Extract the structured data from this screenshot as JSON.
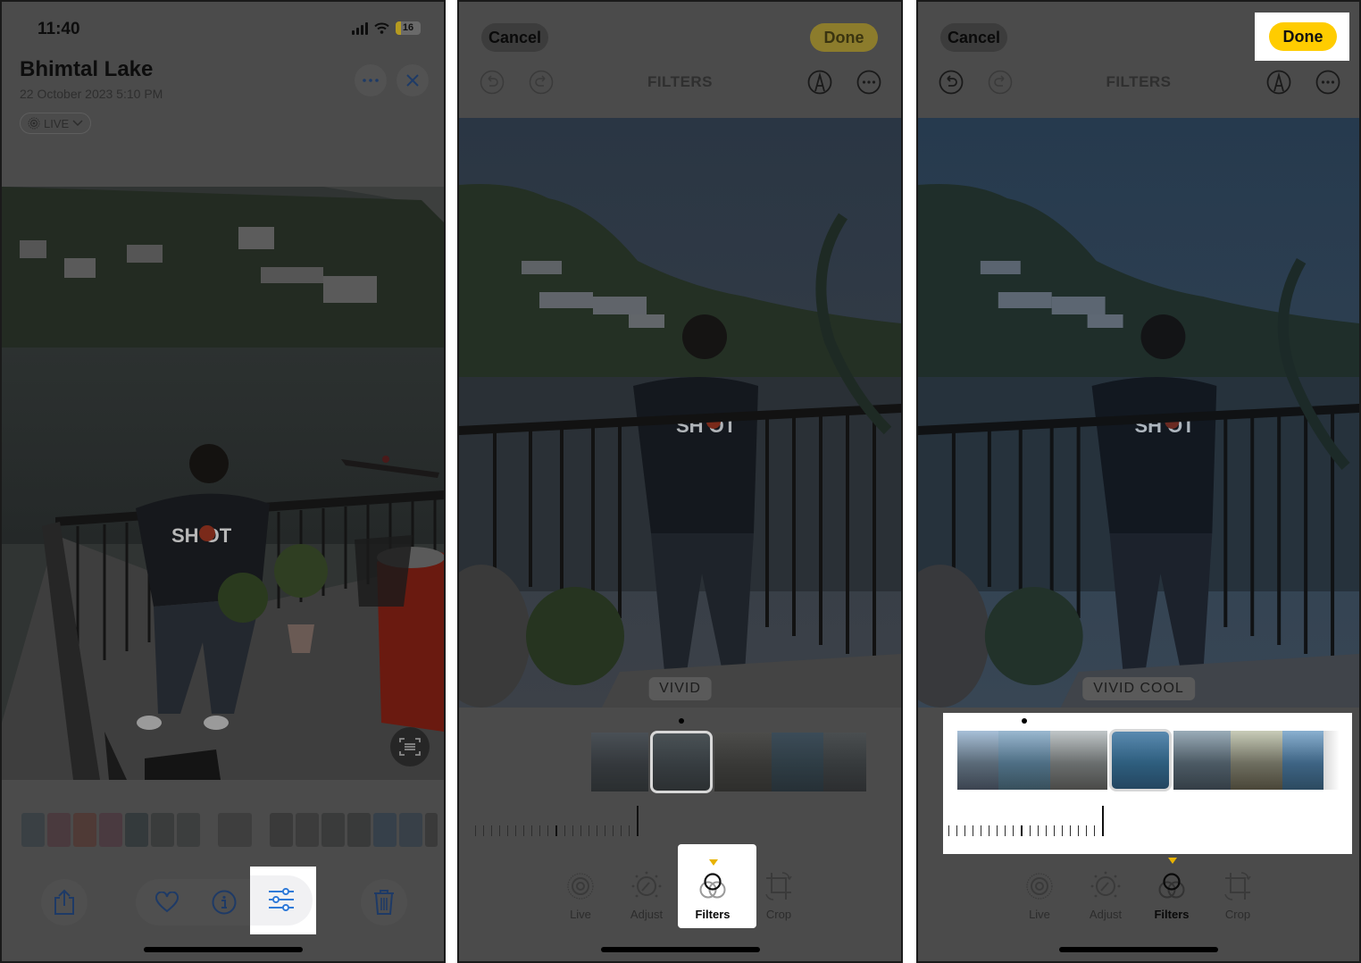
{
  "panel1": {
    "status": {
      "time": "11:40",
      "battery": "16"
    },
    "title": "Bhimtal Lake",
    "date": "22 October 2023  5:10 PM",
    "live_label": "LIVE",
    "icons": {
      "more": "ellipsis-icon",
      "close": "close-icon",
      "live_text": "live-text-scan-icon",
      "share": "share-icon",
      "favorite": "heart-icon",
      "info": "info-icon",
      "edit": "sliders-icon",
      "delete": "trash-icon"
    },
    "highlight": "edit"
  },
  "panel2": {
    "cancel_label": "Cancel",
    "done_label": "Done",
    "mode_title": "FILTERS",
    "filter_name": "VIVID",
    "tabs": [
      {
        "label": "Live",
        "icon": "live-icon"
      },
      {
        "label": "Adjust",
        "icon": "adjust-dial-icon"
      },
      {
        "label": "Filters",
        "icon": "filters-circles-icon",
        "active": true
      },
      {
        "label": "Crop",
        "icon": "crop-rotate-icon"
      }
    ],
    "highlight": "Filters tab"
  },
  "panel3": {
    "cancel_label": "Cancel",
    "done_label": "Done",
    "mode_title": "FILTERS",
    "filter_name": "VIVID COOL",
    "tabs": [
      {
        "label": "Live",
        "icon": "live-icon"
      },
      {
        "label": "Adjust",
        "icon": "adjust-dial-icon"
      },
      {
        "label": "Filters",
        "icon": "filters-circles-icon",
        "active": true
      },
      {
        "label": "Crop",
        "icon": "crop-rotate-icon"
      }
    ],
    "highlight": "Done button and filter strip"
  },
  "colors": {
    "accent_blue": "#1e3a66",
    "done_yellow": "#ffcc00",
    "caret_yellow": "#e8b300",
    "overlay": "#4b4b4b"
  }
}
